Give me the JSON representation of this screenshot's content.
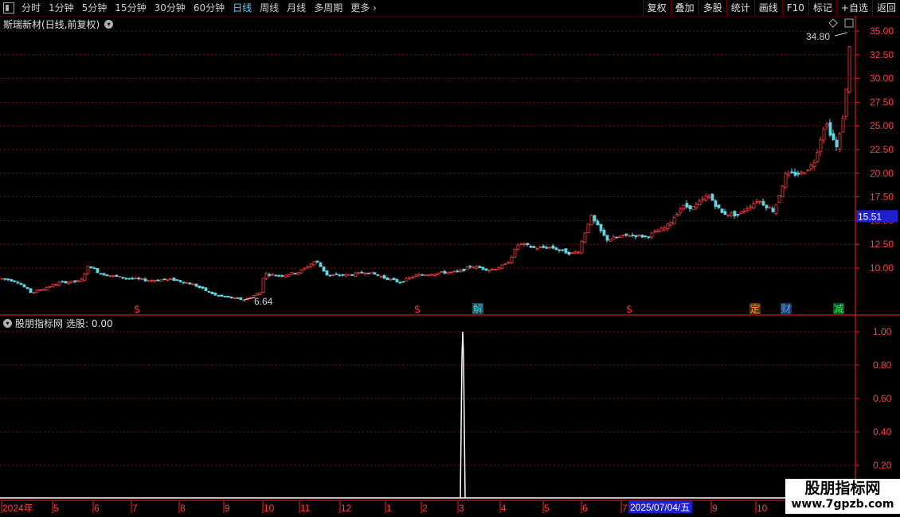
{
  "toolbar": {
    "tabs": [
      {
        "label": "分时",
        "active": false
      },
      {
        "label": "1分钟",
        "active": false
      },
      {
        "label": "5分钟",
        "active": false
      },
      {
        "label": "15分钟",
        "active": false
      },
      {
        "label": "30分钟",
        "active": false
      },
      {
        "label": "60分钟",
        "active": false
      },
      {
        "label": "日线",
        "active": true
      },
      {
        "label": "周线",
        "active": false
      },
      {
        "label": "月线",
        "active": false
      },
      {
        "label": "多周期",
        "active": false
      },
      {
        "label": "更多",
        "active": false
      }
    ],
    "right": [
      "复权",
      "叠加",
      "多股",
      "统计",
      "画线",
      "F10",
      "标记",
      "+自选",
      "返回"
    ]
  },
  "main_chart": {
    "title": "斯瑞新材(日线,前复权)",
    "price_axis": [
      "35.00",
      "32.50",
      "30.00",
      "27.50",
      "25.00",
      "22.50",
      "20.00",
      "17.50",
      "15.00",
      "12.50",
      "10.00"
    ],
    "current_price": "15.51",
    "high_label": "34.80",
    "low_label": "6.64",
    "event_markers": [
      {
        "glyph": "$",
        "color": "#ff3030"
      },
      {
        "glyph": "$",
        "color": "#ff3030"
      },
      {
        "glyph": "解",
        "color": "#40c8e0"
      },
      {
        "glyph": "$",
        "color": "#ff3030"
      },
      {
        "glyph": "定",
        "color": "#ff8c2a"
      },
      {
        "glyph": "财",
        "color": "#4aa0ff"
      },
      {
        "glyph": "减",
        "color": "#30e060"
      }
    ],
    "colors": {
      "up": "#ff3b3b",
      "down": "#5ad9e6",
      "grid": "#7a1010",
      "axis": "#ff2020"
    }
  },
  "sub_chart": {
    "title": "股朋指标网",
    "value_label": "选股: 0.00",
    "axis": [
      "1.00",
      "0.80",
      "0.60",
      "0.40",
      "0.20"
    ]
  },
  "time_axis": {
    "labels": [
      "2024年",
      "5",
      "6",
      "7",
      "8",
      "9",
      "10",
      "11",
      "12",
      "1",
      "2",
      "3",
      "4",
      "5",
      "6",
      "7",
      "9",
      "10"
    ],
    "cursor_date": "2025/07/04/五"
  },
  "watermark": {
    "line1": "股朋指标网",
    "line2": "www.7gpzb.com"
  },
  "chart_data": {
    "type": "candlestick",
    "title": "斯瑞新材(日线,前复权)",
    "ylim": [
      6,
      35.5
    ],
    "close_series": [
      {
        "t": 0,
        "v": 8.9
      },
      {
        "t": 20,
        "v": 8.6
      },
      {
        "t": 38,
        "v": 7.4
      },
      {
        "t": 55,
        "v": 7.9
      },
      {
        "t": 75,
        "v": 8.5
      },
      {
        "t": 100,
        "v": 8.6
      },
      {
        "t": 110,
        "v": 10.3
      },
      {
        "t": 125,
        "v": 9.4
      },
      {
        "t": 150,
        "v": 9.0
      },
      {
        "t": 185,
        "v": 8.7
      },
      {
        "t": 215,
        "v": 8.8
      },
      {
        "t": 240,
        "v": 8.3
      },
      {
        "t": 270,
        "v": 7.1
      },
      {
        "t": 305,
        "v": 6.64
      },
      {
        "t": 325,
        "v": 7.4
      },
      {
        "t": 330,
        "v": 9.4
      },
      {
        "t": 350,
        "v": 9.2
      },
      {
        "t": 375,
        "v": 9.6
      },
      {
        "t": 395,
        "v": 10.8
      },
      {
        "t": 410,
        "v": 9.2
      },
      {
        "t": 440,
        "v": 9.3
      },
      {
        "t": 460,
        "v": 9.6
      },
      {
        "t": 480,
        "v": 9.0
      },
      {
        "t": 500,
        "v": 8.5
      },
      {
        "t": 520,
        "v": 9.2
      },
      {
        "t": 550,
        "v": 9.5
      },
      {
        "t": 575,
        "v": 9.6
      },
      {
        "t": 590,
        "v": 10.2
      },
      {
        "t": 615,
        "v": 9.8
      },
      {
        "t": 635,
        "v": 10.4
      },
      {
        "t": 650,
        "v": 12.6
      },
      {
        "t": 670,
        "v": 12.1
      },
      {
        "t": 690,
        "v": 12.2
      },
      {
        "t": 715,
        "v": 11.5
      },
      {
        "t": 725,
        "v": 11.8
      },
      {
        "t": 740,
        "v": 15.5
      },
      {
        "t": 760,
        "v": 13.0
      },
      {
        "t": 790,
        "v": 13.5
      },
      {
        "t": 810,
        "v": 13.3
      },
      {
        "t": 835,
        "v": 14.3
      },
      {
        "t": 855,
        "v": 16.5
      },
      {
        "t": 870,
        "v": 16.4
      },
      {
        "t": 888,
        "v": 17.7
      },
      {
        "t": 905,
        "v": 15.8
      },
      {
        "t": 925,
        "v": 15.6
      },
      {
        "t": 950,
        "v": 17.2
      },
      {
        "t": 970,
        "v": 16.0
      },
      {
        "t": 985,
        "v": 19.8
      },
      {
        "t": 1005,
        "v": 20.0
      },
      {
        "t": 1020,
        "v": 21.0
      },
      {
        "t": 1035,
        "v": 25.5
      },
      {
        "t": 1050,
        "v": 22.5
      },
      {
        "t": 1060,
        "v": 27.5
      },
      {
        "t": 1066,
        "v": 34.8
      }
    ],
    "signal": [
      {
        "t": 581,
        "v": 1.0
      }
    ]
  }
}
